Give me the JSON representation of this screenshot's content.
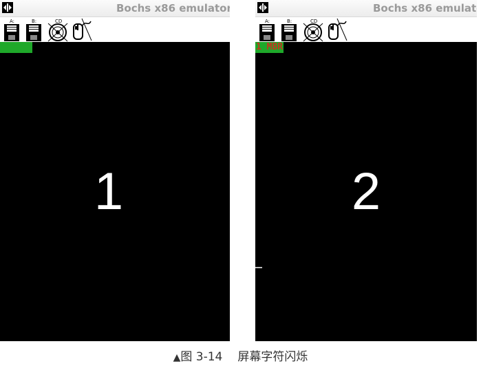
{
  "panels": [
    {
      "title": "Bochs x86 emulator,",
      "toolbar": {
        "floppy_a_label": "A:",
        "floppy_b_label": "B:",
        "cdrom_label": "CD"
      },
      "screen_label": "1",
      "status_text": ""
    },
    {
      "title": "Bochs x86 emulato",
      "toolbar": {
        "floppy_a_label": "A:",
        "floppy_b_label": "B:",
        "cdrom_label": "CD"
      },
      "screen_label": "2",
      "status_text": "1 MBR"
    }
  ],
  "caption": {
    "marker": "▲",
    "figure": "图 3-14",
    "text": "屏幕字符闪烁"
  },
  "colors": {
    "screen_bg": "#000000",
    "highlight_green": "#1fa82a",
    "mbr_text_red": "#c8341e",
    "title_gray": "#9a9a9a"
  },
  "icons": [
    "bochs-app-icon",
    "floppy-a-icon",
    "floppy-b-icon",
    "cdrom-icon",
    "mouse-icon"
  ]
}
